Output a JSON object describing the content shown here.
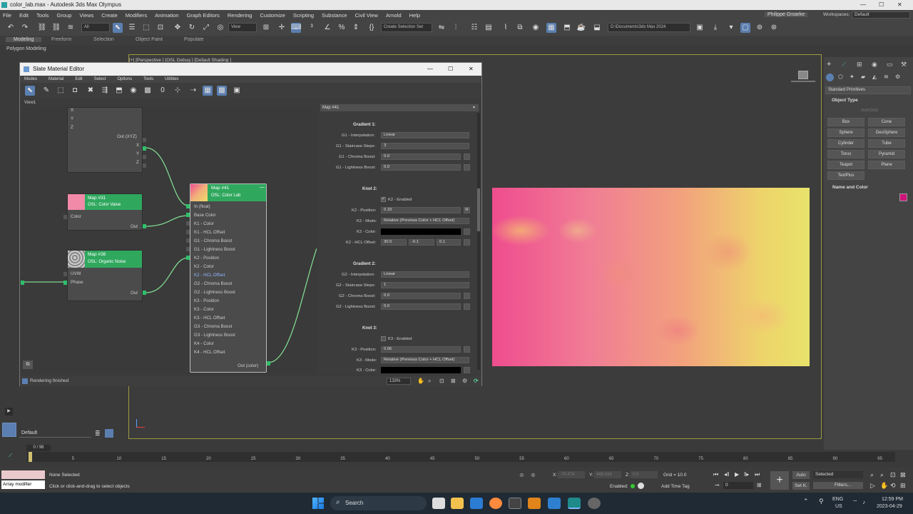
{
  "app": {
    "title": "color_lab.max - Autodesk 3ds Max Olympus"
  },
  "window_controls": {
    "minimize": "—",
    "maximize": "☐",
    "close": "✕"
  },
  "menu": [
    "File",
    "Edit",
    "Tools",
    "Group",
    "Views",
    "Create",
    "Modifiers",
    "Animation",
    "Graph Editors",
    "Rendering",
    "Customize",
    "Scripting",
    "Substance",
    "Civil View",
    "Arnold",
    "Help"
  ],
  "user": "Philippe Groarke",
  "workspaces": {
    "label": "Workspaces:",
    "value": "Default"
  },
  "toolbar": {
    "filter": "All",
    "view": "View",
    "selection_set": "Create Selection Set",
    "path": "D:\\Documents\\3ds Max 2024"
  },
  "ribbon": {
    "tabs": [
      "Modeling",
      "Freeform",
      "Selection",
      "Object Paint",
      "Populate"
    ],
    "sub": "Polygon Modeling"
  },
  "viewport": {
    "label": "[+] [Perspective ] [OSL Debug ] [Default Shading ]"
  },
  "command_panel": {
    "dropdown": "Standard Primitives",
    "object_type": "Object Type",
    "autogrid": "AutoGrid",
    "buttons": [
      "Box",
      "Cone",
      "Sphere",
      "GeoSphere",
      "Cylinder",
      "Tube",
      "Torus",
      "Pyramid",
      "Teapot",
      "Plane",
      "TextPlus"
    ],
    "name_color": "Name and Color",
    "swatch_color": "#d0137a"
  },
  "sme": {
    "title": "Slate Material Editor",
    "menu": [
      "Modes",
      "Material",
      "Edit",
      "Select",
      "Options",
      "Tools",
      "Utilities"
    ],
    "view_tab": "View1",
    "nodes": {
      "top_ports": [
        "X",
        "Y",
        "Z"
      ],
      "top_out": "Out (XYZ)",
      "top_out_ports": [
        "X",
        "Y",
        "Z"
      ],
      "n31": {
        "title": "Map #31",
        "sub": "OSL: Color Value",
        "in": "Color",
        "out": "Out"
      },
      "n38": {
        "title": "Map #38",
        "sub": "OSL: Organic Noise",
        "in": [
          "UVW",
          "Phase"
        ],
        "out": "Out"
      },
      "n41": {
        "title": "Map #41",
        "sub": "OSL: Color Lab",
        "ports": [
          "In (float)",
          "Base Color",
          "K1 - Color",
          "K1 - HCL Offset",
          "G1 - Chroma Boost",
          "G1 - Lightness Boost",
          "K2 - Position",
          "K2 - Color",
          "K2 - HCL Offset",
          "G2 - Chroma Boost",
          "G2 - Lightness Boost",
          "K3 - Position",
          "K3 - Color",
          "K3 - HCL Offset",
          "G3 - Chroma Boost",
          "G3 - Lightness Boost",
          "K4 - Color",
          "K4 - HCL Offset"
        ],
        "out": "Out (color)"
      }
    },
    "props": {
      "header": "Map #41",
      "g1": {
        "title": "Gradient 1:",
        "interp_label": "G1 - Interpolation:",
        "interp": "Linear",
        "steps_label": "G1 - Staircase Steps:",
        "steps": "3",
        "chroma_label": "G1 - Chroma Boost:",
        "chroma": "0.0",
        "light_label": "G1 - Lightness Boost:",
        "light": "0.0"
      },
      "k2": {
        "title": "Knot 2:",
        "enabled": "K2 - Enabled",
        "pos_label": "K2 - Position:",
        "pos": "0.33",
        "m": "M",
        "mode_label": "K2 - Mode:",
        "mode": "Relative (Previous Color + HCL Offset)",
        "color_label": "K2 - Color:",
        "hcl_label": "K2 - HCL Offset:",
        "hcl": [
          "30.0",
          "-0.1",
          "0.1"
        ]
      },
      "g2": {
        "title": "Gradient 2:",
        "interp_label": "G2 - Interpolation:",
        "interp": "Linear",
        "steps_label": "G2 - Staircase Steps:",
        "steps": "1",
        "chroma_label": "G2 - Chroma Boost:",
        "chroma": "0.0",
        "light_label": "G2 - Lightness Boost:",
        "light": "0.0"
      },
      "k3": {
        "title": "Knot 3:",
        "enabled": "K3 - Enabled",
        "pos_label": "K3 - Position:",
        "pos": "0.66",
        "mode_label": "K3 - Mode:",
        "mode": "Relative (Previous Color + HCL Offset)",
        "color_label": "K3 - Color:"
      }
    },
    "status": "Rendering finished",
    "zoom": "133%"
  },
  "layer": "Default",
  "time": {
    "frame": "0 / 96",
    "ticks": [
      "0",
      "5",
      "10",
      "15",
      "20",
      "25",
      "30",
      "35",
      "40",
      "45",
      "50",
      "55",
      "60",
      "65",
      "70",
      "75",
      "80",
      "85",
      "90",
      "95"
    ]
  },
  "status": {
    "script": "Array modifier",
    "selection": "None Selected",
    "hint": "Click or click-and-drag to select objects",
    "x": "X:",
    "x_val": "-79.474",
    "y": "Y:",
    "y_val": "448.834",
    "z": "Z:",
    "z_val": "0.0",
    "grid": "Grid = 10.0",
    "enabled": "Enabled:",
    "add_time_tag": "Add Time Tag",
    "auto": "Auto",
    "selected": "Selected",
    "setk": "Set K.",
    "filters": "Filters...",
    "frame": "0"
  },
  "taskbar": {
    "search": "Search",
    "lang": "ENG",
    "region": "US",
    "time": "12:59 PM",
    "date": "2023-04-29"
  }
}
